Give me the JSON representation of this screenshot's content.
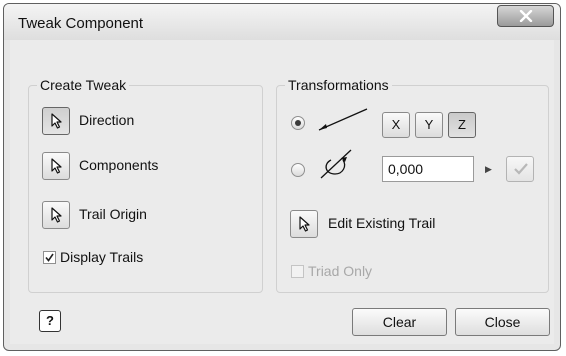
{
  "window": {
    "title": "Tweak Component"
  },
  "create_tweak": {
    "label": "Create Tweak",
    "direction_label": "Direction",
    "components_label": "Components",
    "trail_origin_label": "Trail Origin",
    "display_trails_label": "Display Trails",
    "display_trails_checked": true
  },
  "transformations": {
    "label": "Transformations",
    "move_selected": true,
    "rotate_selected": false,
    "axes": [
      "X",
      "Y",
      "Z"
    ],
    "active_axis": "Z",
    "value": "0,000",
    "edit_trail_label": "Edit Existing Trail",
    "triad_only_label": "Triad Only",
    "triad_only_enabled": false
  },
  "footer": {
    "help_label": "?",
    "clear_label": "Clear",
    "close_label": "Close"
  }
}
